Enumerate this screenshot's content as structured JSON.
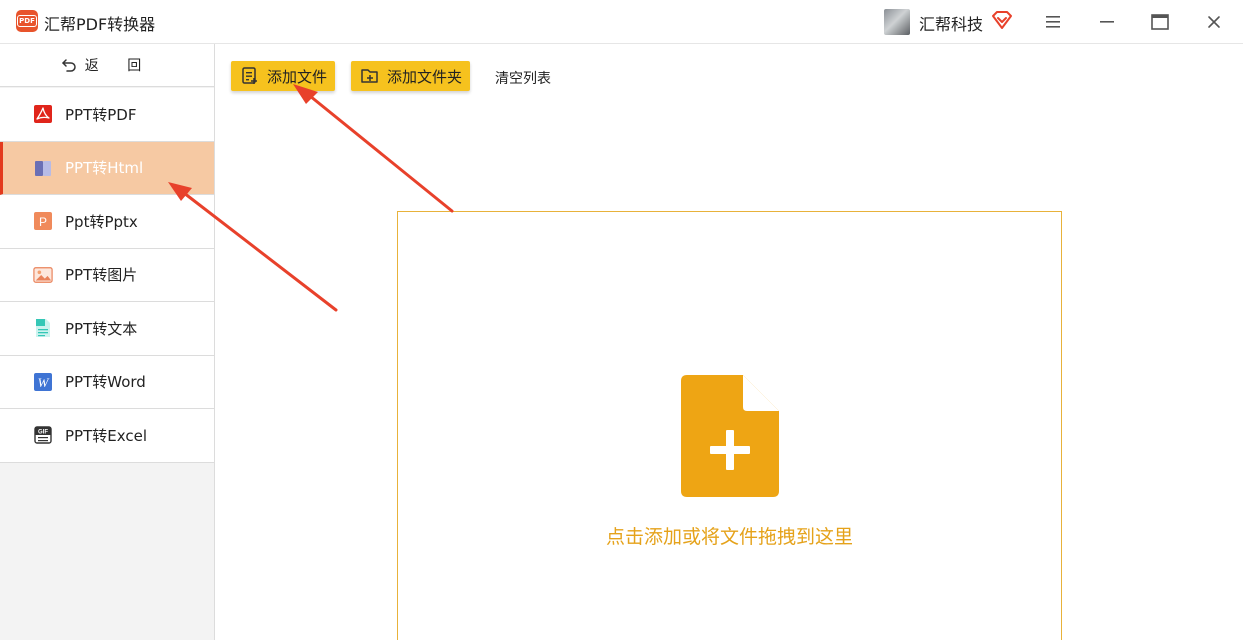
{
  "window": {
    "app_title": "汇帮PDF转换器",
    "logo_text": "PDF",
    "user_name": "汇帮科技",
    "icons": {
      "vip": "diamond-icon",
      "menu": "hamburger-menu-icon",
      "minimize": "minimize-icon",
      "maximize": "maximize-icon",
      "close": "close-icon"
    }
  },
  "sidebar": {
    "back_label": "返 回",
    "items": [
      {
        "label": "PPT转PDF",
        "icon": "pdf-icon",
        "active": false
      },
      {
        "label": "PPT转Html",
        "icon": "html-book-icon",
        "active": true
      },
      {
        "label": "Ppt转Pptx",
        "icon": "pptx-icon",
        "active": false
      },
      {
        "label": "PPT转图片",
        "icon": "image-icon",
        "active": false
      },
      {
        "label": "PPT转文本",
        "icon": "text-doc-icon",
        "active": false
      },
      {
        "label": "PPT转Word",
        "icon": "word-icon",
        "active": false
      },
      {
        "label": "PPT转Excel",
        "icon": "gif-icon",
        "active": false
      }
    ]
  },
  "toolbar": {
    "add_file_label": "添加文件",
    "add_folder_label": "添加文件夹",
    "clear_label": "清空列表"
  },
  "drop_zone": {
    "hint": "点击添加或将文件拖拽到这里",
    "icon": "add-file-icon"
  },
  "colors": {
    "accent": "#f6c21e",
    "active_item_bg": "#f6c9a3",
    "active_item_border": "#e33a1e",
    "drop_border": "#e8b23a",
    "drop_icon": "#eea514",
    "annotation_arrow": "#e8412b"
  }
}
